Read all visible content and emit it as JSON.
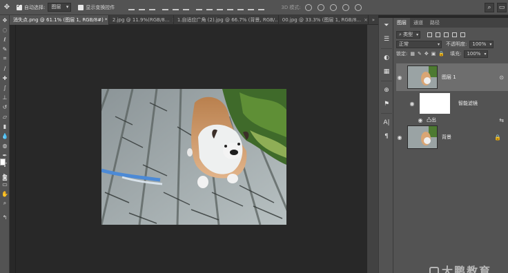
{
  "options_bar": {
    "auto_select_label": "自动选择:",
    "auto_select_value": "图层",
    "show_transform_label": "显示变换控件",
    "mode3d_label": "3D 模式:"
  },
  "tabs": [
    {
      "label": "消失点.png @ 61.1% (图层 1, RGB/8#) *",
      "active": true
    },
    {
      "label": "2.jpg @ 11.9%(RGB/8...",
      "active": false
    },
    {
      "label": "1.自适应广角 (2).jpg @ 66.7% (背景, RGB/...",
      "active": false
    },
    {
      "label": "00.jpg @ 33.3% (图层 1, RGB/8...",
      "active": false
    }
  ],
  "layers_panel": {
    "tabs": [
      "图层",
      "通道",
      "路径"
    ],
    "kind_filter": "类型",
    "blend_mode": "正常",
    "opacity_label": "不透明度:",
    "opacity_value": "100%",
    "lock_label": "锁定:",
    "fill_label": "填充:",
    "fill_value": "100%",
    "layers": [
      {
        "name": "图层 1",
        "selected": true
      },
      {
        "name": "智能滤镜",
        "selected": false
      },
      {
        "name": "凸出",
        "selected": false
      },
      {
        "name": "背景",
        "selected": false
      }
    ]
  },
  "watermark": "大鹏教育",
  "colors": {
    "ui_panel": "#535353",
    "canvas_bg": "#282828",
    "selected_layer": "#6e6e6e"
  }
}
